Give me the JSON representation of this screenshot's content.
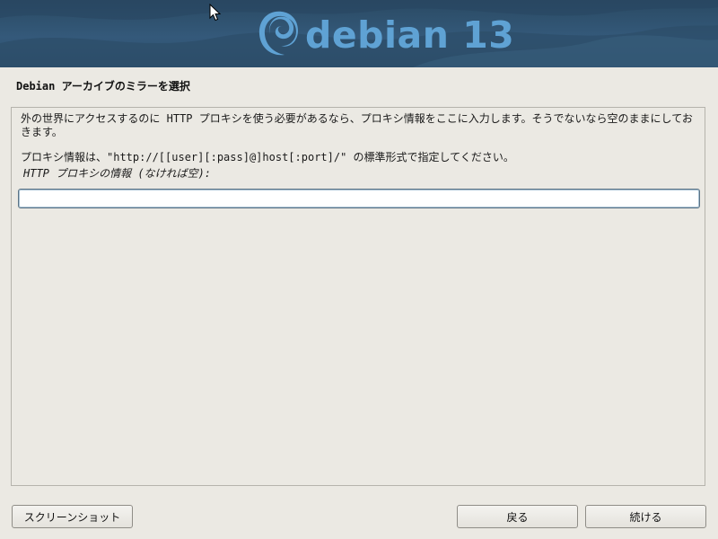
{
  "header": {
    "logo_text": "debian 13",
    "logo_icon": "debian-swirl-icon",
    "colors": {
      "banner": "#2f5270",
      "logo": "#5fa2d4"
    }
  },
  "step": {
    "title": "Debian アーカイブのミラーを選択"
  },
  "content": {
    "description": "外の世界にアクセスするのに HTTP プロキシを使う必要があるなら、プロキシ情報をここに入力します。そうでないなら空のままにしておきます。",
    "format_hint": "プロキシ情報は、\"http://[[user][:pass]@]host[:port]/\" の標準形式で指定してください。",
    "field_label": "HTTP プロキシの情報 (なければ空):",
    "field_value": ""
  },
  "buttons": {
    "screenshot": "スクリーンショット",
    "back": "戻る",
    "continue": "続ける"
  }
}
